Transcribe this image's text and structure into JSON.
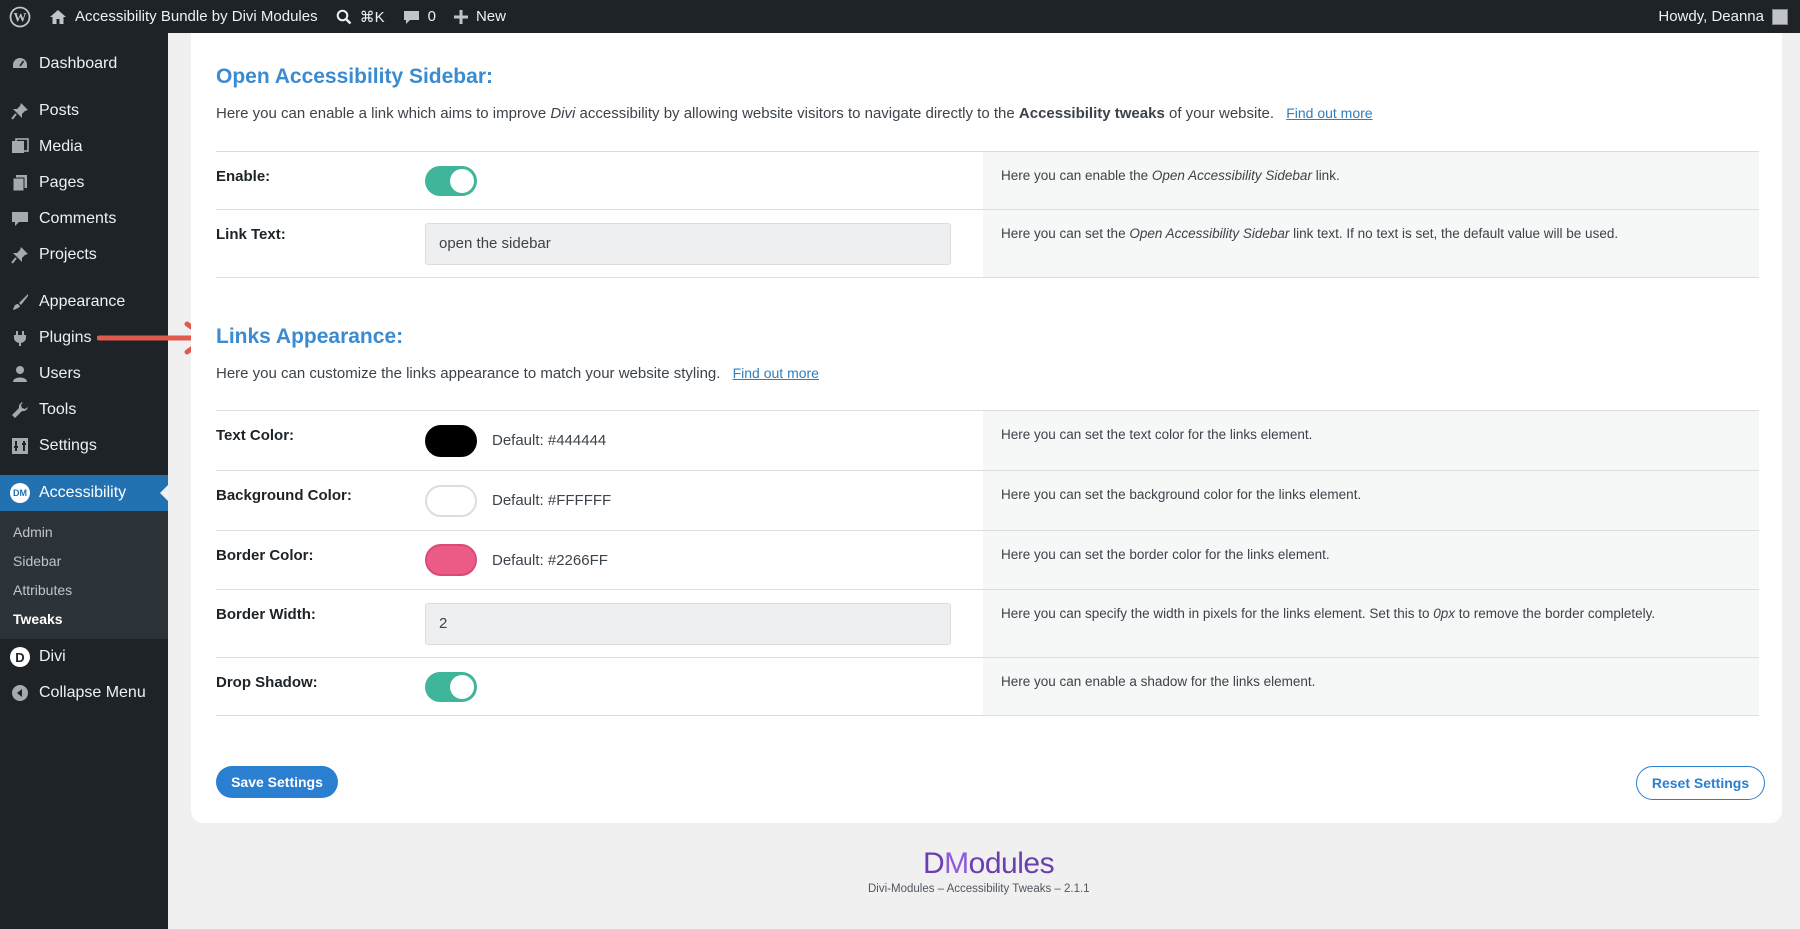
{
  "colors": {
    "accent": "#2271b1",
    "heading": "#3a8bd1",
    "toggle": "#3fb59a",
    "admin_bar": "#1d2327"
  },
  "admin_bar": {
    "site_name": "Accessibility Bundle by Divi Modules",
    "search_shortcut": "⌘K",
    "comments_count": "0",
    "new_label": "New",
    "greeting": "Howdy, Deanna"
  },
  "sidebar": {
    "items": [
      {
        "label": "Dashboard",
        "icon": "dashboard-icon"
      },
      {
        "label": "Posts",
        "icon": "pin-icon"
      },
      {
        "label": "Media",
        "icon": "media-icon"
      },
      {
        "label": "Pages",
        "icon": "pages-icon"
      },
      {
        "label": "Comments",
        "icon": "comment-icon"
      },
      {
        "label": "Projects",
        "icon": "pin-icon"
      },
      {
        "label": "Appearance",
        "icon": "brush-icon"
      },
      {
        "label": "Plugins",
        "icon": "plugin-icon"
      },
      {
        "label": "Users",
        "icon": "user-icon"
      },
      {
        "label": "Tools",
        "icon": "wrench-icon"
      },
      {
        "label": "Settings",
        "icon": "settings-icon"
      },
      {
        "label": "Accessibility",
        "icon": "dm-icon",
        "badge": "DM"
      },
      {
        "label": "Divi",
        "icon": "divi-icon",
        "badge": "D"
      },
      {
        "label": "Collapse Menu",
        "icon": "collapse-icon"
      }
    ],
    "submenu": [
      "Admin",
      "Sidebar",
      "Attributes",
      "Tweaks"
    ]
  },
  "sidebar_section": {
    "title": "Open Accessibility Sidebar:",
    "desc_1": "Here you can enable a link which aims to improve ",
    "desc_em": "Divi",
    "desc_2": " accessibility by allowing website visitors to navigate directly to the ",
    "desc_strong": "Accessibility tweaks",
    "desc_3": " of your website.",
    "link": "Find out more",
    "rows": {
      "enable": {
        "label": "Enable:",
        "help_1": "Here you can enable the ",
        "help_em": "Open Accessibility Sidebar",
        "help_2": " link."
      },
      "link_text": {
        "label": "Link Text:",
        "value": "open the sidebar",
        "help_1": "Here you can set the ",
        "help_em": "Open Accessibility Sidebar",
        "help_2": " link text. If no text is set, the default value will be used."
      }
    }
  },
  "links_section": {
    "title": "Links Appearance:",
    "desc": "Here you can customize the links appearance to match your website styling.",
    "link": "Find out more",
    "rows": {
      "text_color": {
        "label": "Text Color:",
        "swatch": "#000000",
        "default": "Default: #444444",
        "help": "Here you can set the text color for the links element."
      },
      "bg_color": {
        "label": "Background Color:",
        "swatch": "#ffffff",
        "default": "Default: #FFFFFF",
        "help": "Here you can set the background color for the links element."
      },
      "border_color": {
        "label": "Border Color:",
        "swatch": "#ec5a86",
        "default": "Default: #2266FF",
        "help": "Here you can set the border color for the links element."
      },
      "border_width": {
        "label": "Border Width:",
        "value": "2",
        "help_1": "Here you can specify the width in pixels for the links element. Set this to ",
        "help_em": "0px",
        "help_2": " to remove the border completely."
      },
      "drop_shadow": {
        "label": "Drop Shadow:",
        "help": "Here you can enable a shadow for the links element."
      }
    }
  },
  "buttons": {
    "save": "Save Settings",
    "reset": "Reset Settings"
  },
  "footer": {
    "logo_1": "D",
    "logo_m": "M",
    "logo_2": "odules",
    "text": "Divi-Modules – Accessibility Tweaks – 2.1.1"
  }
}
